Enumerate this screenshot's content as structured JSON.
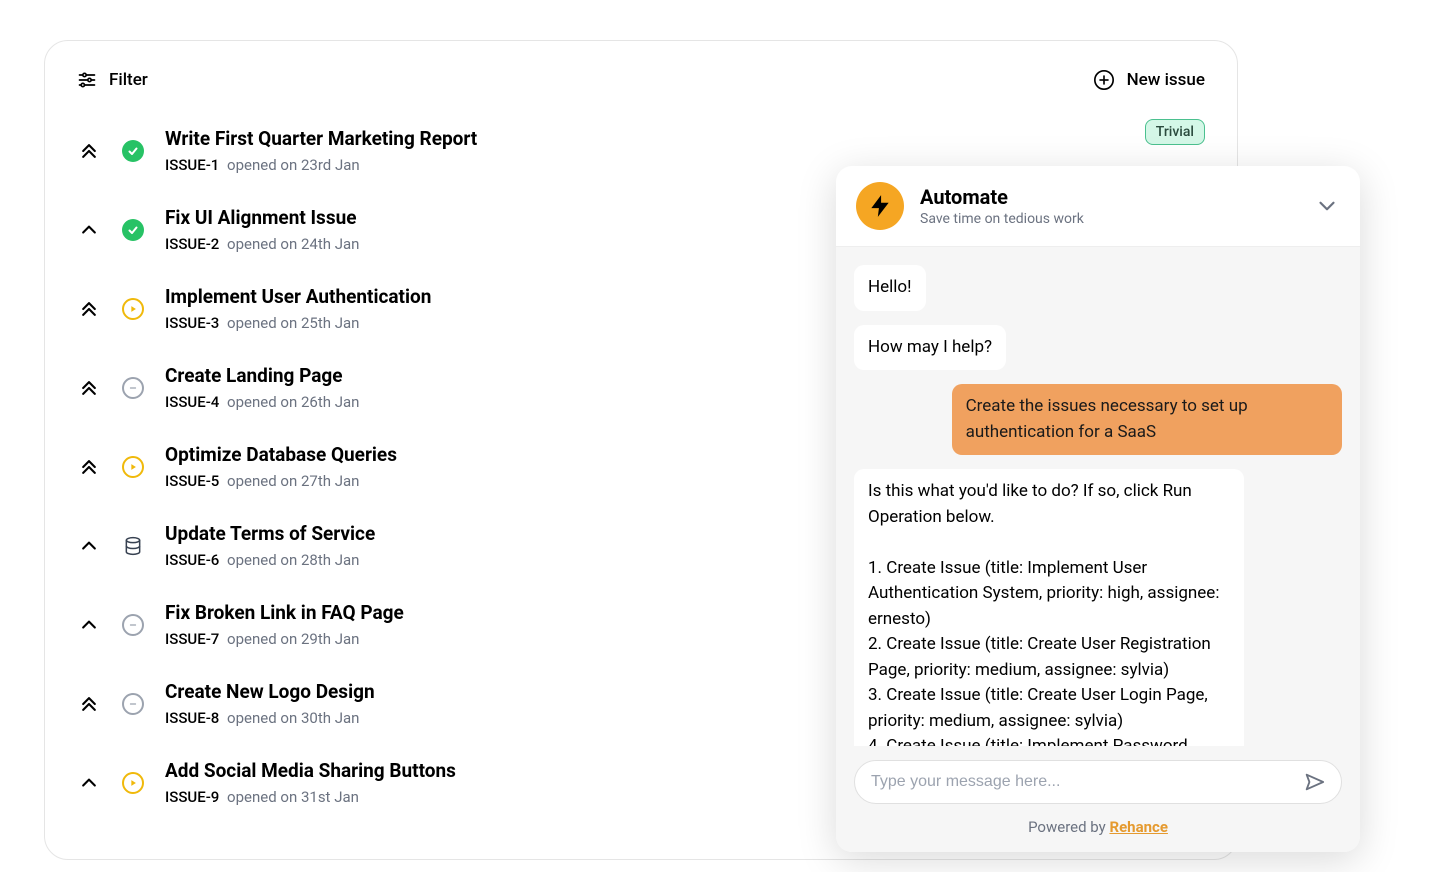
{
  "toolbar": {
    "filter_label": "Filter",
    "new_issue_label": "New issue"
  },
  "issues": [
    {
      "title": "Write First Quarter Marketing Report",
      "id": "ISSUE-1",
      "opened": "opened on 23rd Jan",
      "priority": "highest",
      "status": "done",
      "badge": "Trivial"
    },
    {
      "title": "Fix UI Alignment Issue",
      "id": "ISSUE-2",
      "opened": "opened on 24th Jan",
      "priority": "high",
      "status": "done",
      "badge": null
    },
    {
      "title": "Implement User Authentication",
      "id": "ISSUE-3",
      "opened": "opened on 25th Jan",
      "priority": "highest",
      "status": "in-progress",
      "badge": null
    },
    {
      "title": "Create Landing Page",
      "id": "ISSUE-4",
      "opened": "opened on 26th Jan",
      "priority": "highest",
      "status": "todo",
      "badge": null
    },
    {
      "title": "Optimize Database Queries",
      "id": "ISSUE-5",
      "opened": "opened on 27th Jan",
      "priority": "highest",
      "status": "in-progress",
      "badge": null
    },
    {
      "title": "Update Terms of Service",
      "id": "ISSUE-6",
      "opened": "opened on 28th Jan",
      "priority": "high",
      "status": "backlog",
      "badge": null
    },
    {
      "title": "Fix Broken Link in FAQ Page",
      "id": "ISSUE-7",
      "opened": "opened on 29th Jan",
      "priority": "high",
      "status": "todo",
      "badge": null
    },
    {
      "title": "Create New Logo Design",
      "id": "ISSUE-8",
      "opened": "opened on 30th Jan",
      "priority": "highest",
      "status": "todo",
      "badge": null
    },
    {
      "title": "Add Social Media Sharing Buttons",
      "id": "ISSUE-9",
      "opened": "opened on 31st Jan",
      "priority": "high",
      "status": "in-progress",
      "badge": null
    }
  ],
  "chat": {
    "title": "Automate",
    "subtitle": "Save time on tedious work",
    "messages": [
      {
        "role": "bot",
        "text": "Hello!"
      },
      {
        "role": "bot",
        "text": "How may I help?"
      },
      {
        "role": "user",
        "text": "Create the issues necessary to set up authentication for a SaaS"
      },
      {
        "role": "bot",
        "text": "Is this what you'd like to do? If so, click Run Operation below.\n\n1. Create Issue (title: Implement User Authentication System, priority: high, assignee: ernesto)\n2. Create Issue (title: Create User Registration Page, priority: medium, assignee: sylvia)\n3. Create Issue (title: Create User Login Page, priority: medium, assignee: sylvia)\n4. Create Issue (title: Implement Password"
      }
    ],
    "input_placeholder": "Type your message here...",
    "footer_prefix": "Powered by ",
    "footer_link": "Rehance"
  }
}
